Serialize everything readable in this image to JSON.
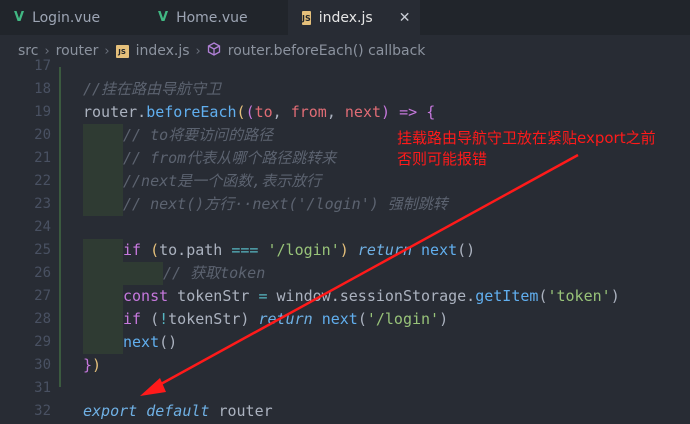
{
  "tabs": [
    {
      "label": "Login.vue",
      "icon": "vue-icon"
    },
    {
      "label": "Home.vue",
      "icon": "vue-icon"
    },
    {
      "label": "index.js",
      "icon": "js-icon",
      "active": true
    }
  ],
  "tab_icon_text": "JS",
  "close_glyph": "✕",
  "breadcrumb": [
    "src",
    "router",
    "index.js",
    "router.beforeEach() callback"
  ],
  "annotation": {
    "line1": "挂载路由导航守卫放在紧贴export之前",
    "line2": "否则可能报错"
  },
  "colors": {
    "annotation": "#ff1a1a",
    "arrow": "#ff1a1a"
  },
  "lines": [
    {
      "n": "17",
      "code": ""
    },
    {
      "n": "18",
      "code": "//挂在路由导航守卫"
    },
    {
      "n": "19",
      "code": "router.beforeEach((to, from, next) => {"
    },
    {
      "n": "20",
      "code": "// to将要访问的路径"
    },
    {
      "n": "21",
      "code": "// from代表从哪个路径跳转来"
    },
    {
      "n": "22",
      "code": "//next是一个函数,表示放行"
    },
    {
      "n": "23",
      "code": "// next()方行··next('/login') 强制跳转"
    },
    {
      "n": "24",
      "code": ""
    },
    {
      "n": "25",
      "code": "if (to.path === '/login') return next()"
    },
    {
      "n": "26",
      "code": "// 获取token"
    },
    {
      "n": "27",
      "code": "const tokenStr = window.sessionStorage.getItem('token')"
    },
    {
      "n": "28",
      "code": "if (!tokenStr) return next('/login')"
    },
    {
      "n": "29",
      "code": "next()"
    },
    {
      "n": "30",
      "code": "})"
    },
    {
      "n": "31",
      "code": ""
    },
    {
      "n": "32",
      "code": "export default router"
    }
  ]
}
